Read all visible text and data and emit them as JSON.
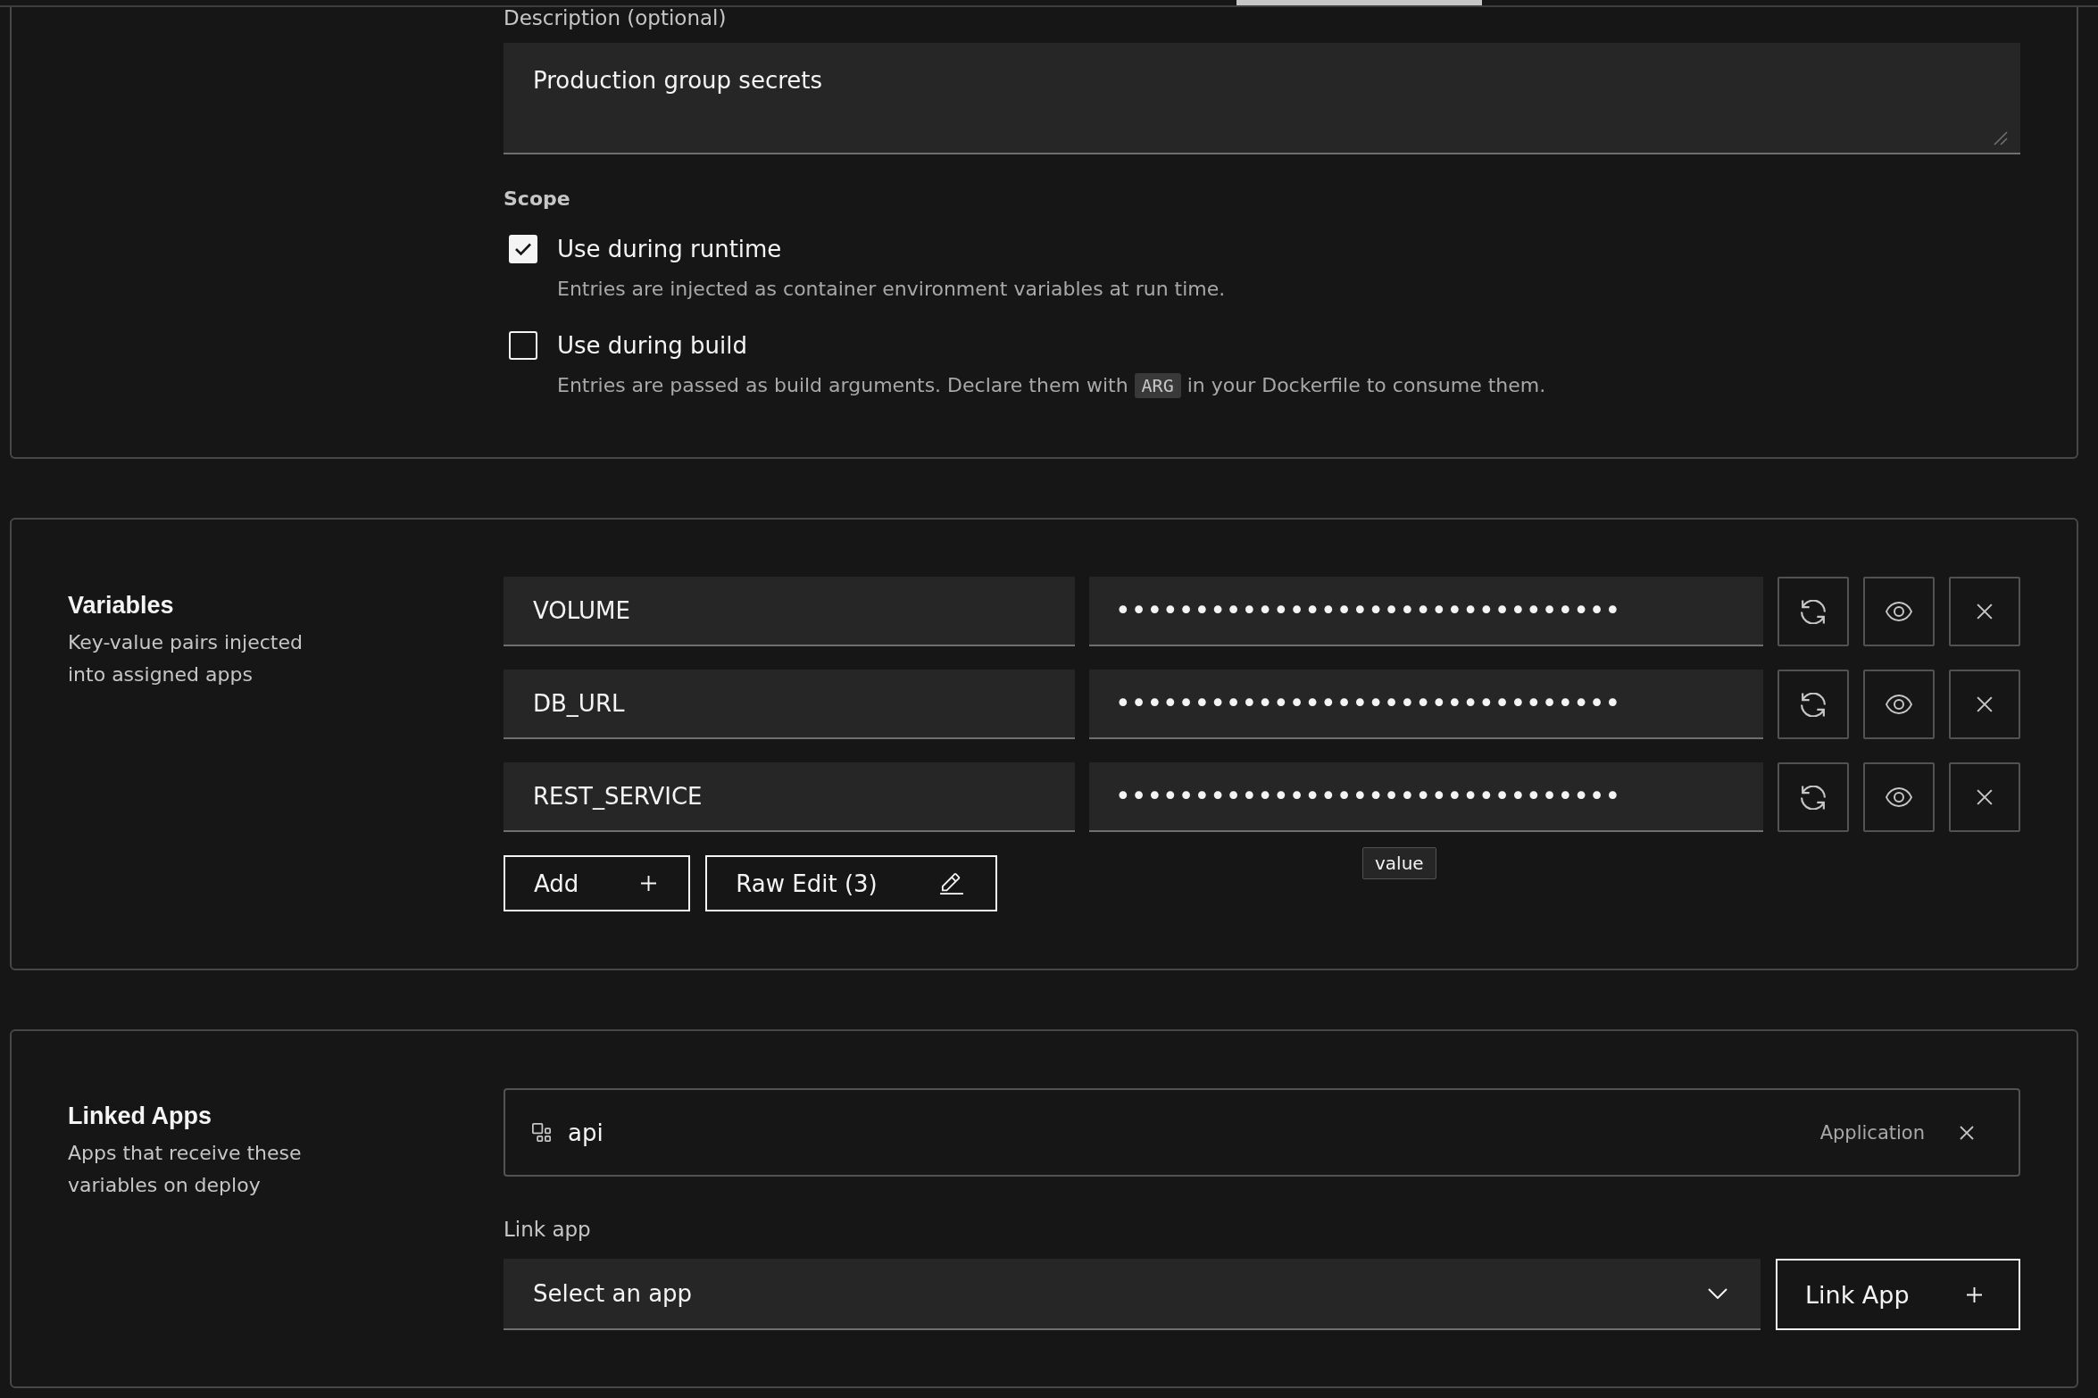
{
  "details": {
    "description": {
      "label": "Description (optional)",
      "value": "Production group secrets"
    },
    "scope": {
      "label": "Scope",
      "options": [
        {
          "label": "Use during runtime",
          "checked": true,
          "help": [
            {
              "kind": "text",
              "text": "Entries are injected as container environment variables at run time."
            }
          ]
        },
        {
          "label": "Use during build",
          "checked": false,
          "help": [
            {
              "kind": "text",
              "text": "Entries are passed as build arguments. Declare them with"
            },
            {
              "kind": "code",
              "text": "ARG"
            },
            {
              "kind": "text",
              "text": "in your Dockerfile to consume them."
            }
          ]
        }
      ]
    }
  },
  "variables": {
    "title": "Variables",
    "description": "Key-value pairs injected into assigned apps",
    "rows": [
      {
        "key": "VOLUME",
        "value": "••••••••••••••••••••••••••••••••"
      },
      {
        "key": "DB_URL",
        "value": "••••••••••••••••••••••••••••••••"
      },
      {
        "key": "REST_SERVICE",
        "value": "••••••••••••••••••••••••••••••••",
        "tooltip": "value"
      }
    ],
    "actions": [
      {
        "kind": "add",
        "label": "Add"
      },
      {
        "kind": "edit",
        "label": "Raw Edit (3)"
      }
    ]
  },
  "linked_apps": {
    "title": "Linked Apps",
    "description": "Apps that receive these variables on deploy",
    "apps": [
      {
        "name": "api",
        "type": "Application"
      }
    ],
    "link_field": {
      "label": "Link app",
      "placeholder": "Select an app"
    },
    "link_button": "Link App"
  }
}
